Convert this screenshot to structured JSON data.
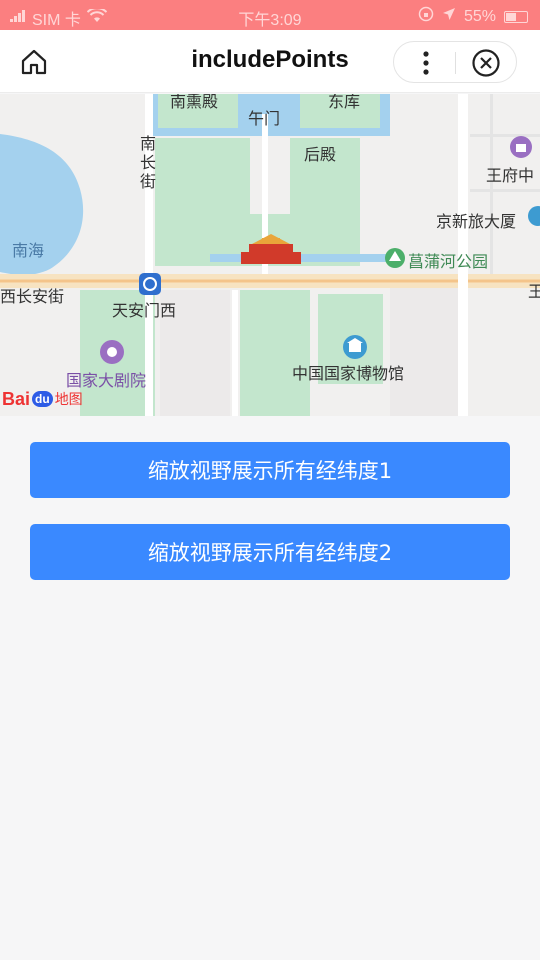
{
  "status_bar": {
    "carrier": "SIM 卡",
    "time": "下午3:09",
    "battery": "55%",
    "battery_level": 0.55
  },
  "nav": {
    "title": "includePoints",
    "home_icon": "home-icon",
    "more_icon": "more-vertical-icon",
    "close_icon": "close-circle-icon"
  },
  "map": {
    "labels": {
      "nanxundian": "南熏殿",
      "wumen": "午门",
      "dongku": "东库",
      "nanchangjie": "南长街",
      "houdian": "后殿",
      "wangfuzhong": "王府中",
      "jingxin": "京新旅大厦",
      "nanhai": "南海",
      "pupuhe": "菖蒲河公园",
      "xichanganjie": "西长安街",
      "tiananmenxi": "天安门西",
      "wang2": "王",
      "guojiadajuyuan": "国家大剧院",
      "guojiabowuguan": "中国国家博物馆"
    },
    "logo": {
      "bai": "Bai",
      "du": "du",
      "ditu": "地图"
    }
  },
  "buttons": {
    "btn1": "缩放视野展示所有经纬度1",
    "btn2": "缩放视野展示所有经纬度2"
  }
}
